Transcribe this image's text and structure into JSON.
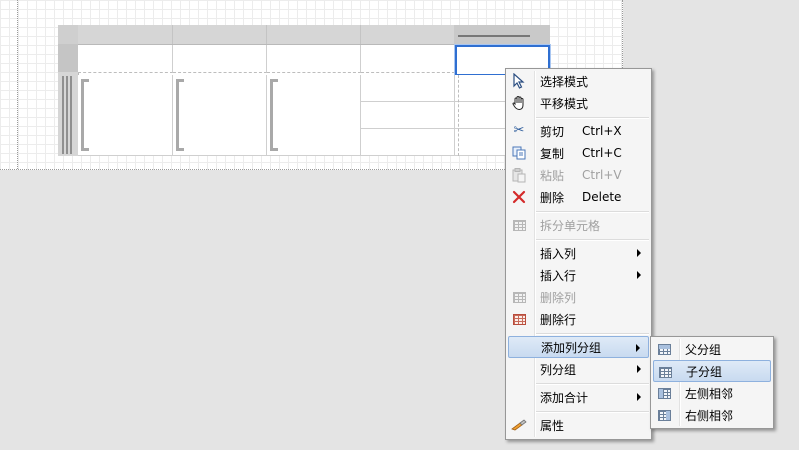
{
  "context_menu": {
    "items": [
      {
        "label": "选择模式",
        "shortcut": "",
        "icon": "pointer-icon",
        "disabled": false,
        "submenu": false
      },
      {
        "label": "平移模式",
        "shortcut": "",
        "icon": "hand-icon",
        "disabled": false,
        "submenu": false
      },
      {
        "label": "剪切",
        "shortcut": "Ctrl+X",
        "icon": "scissors-icon",
        "disabled": false,
        "submenu": false
      },
      {
        "label": "复制",
        "shortcut": "Ctrl+C",
        "icon": "copy-icon",
        "disabled": false,
        "submenu": false
      },
      {
        "label": "粘贴",
        "shortcut": "Ctrl+V",
        "icon": "paste-icon",
        "disabled": true,
        "submenu": false
      },
      {
        "label": "删除",
        "shortcut": "Delete",
        "icon": "delete-x-icon",
        "disabled": false,
        "submenu": false
      },
      {
        "label": "拆分单元格",
        "shortcut": "",
        "icon": "split-cells-icon",
        "disabled": true,
        "submenu": false
      },
      {
        "label": "插入列",
        "shortcut": "",
        "icon": "",
        "disabled": false,
        "submenu": true
      },
      {
        "label": "插入行",
        "shortcut": "",
        "icon": "",
        "disabled": false,
        "submenu": true
      },
      {
        "label": "删除列",
        "shortcut": "",
        "icon": "delete-column-icon",
        "disabled": true,
        "submenu": false
      },
      {
        "label": "删除行",
        "shortcut": "",
        "icon": "delete-row-icon",
        "disabled": false,
        "submenu": false
      },
      {
        "label": "添加列分组",
        "shortcut": "",
        "icon": "",
        "disabled": false,
        "submenu": true
      },
      {
        "label": "列分组",
        "shortcut": "",
        "icon": "",
        "disabled": false,
        "submenu": true
      },
      {
        "label": "添加合计",
        "shortcut": "",
        "icon": "",
        "disabled": false,
        "submenu": true
      },
      {
        "label": "属性",
        "shortcut": "",
        "icon": "properties-icon",
        "disabled": false,
        "submenu": false
      }
    ]
  },
  "submenu": {
    "items": [
      {
        "label": "父分组",
        "icon": "parent-group-icon"
      },
      {
        "label": "子分组",
        "icon": "child-group-icon"
      },
      {
        "label": "左侧相邻",
        "icon": "adjacent-left-icon"
      },
      {
        "label": "右侧相邻",
        "icon": "adjacent-right-icon"
      }
    ]
  },
  "colors": {
    "selection": "#2f6fd1",
    "menu_hover": "#c8daf0",
    "delete_icon": "#d42a2a"
  }
}
